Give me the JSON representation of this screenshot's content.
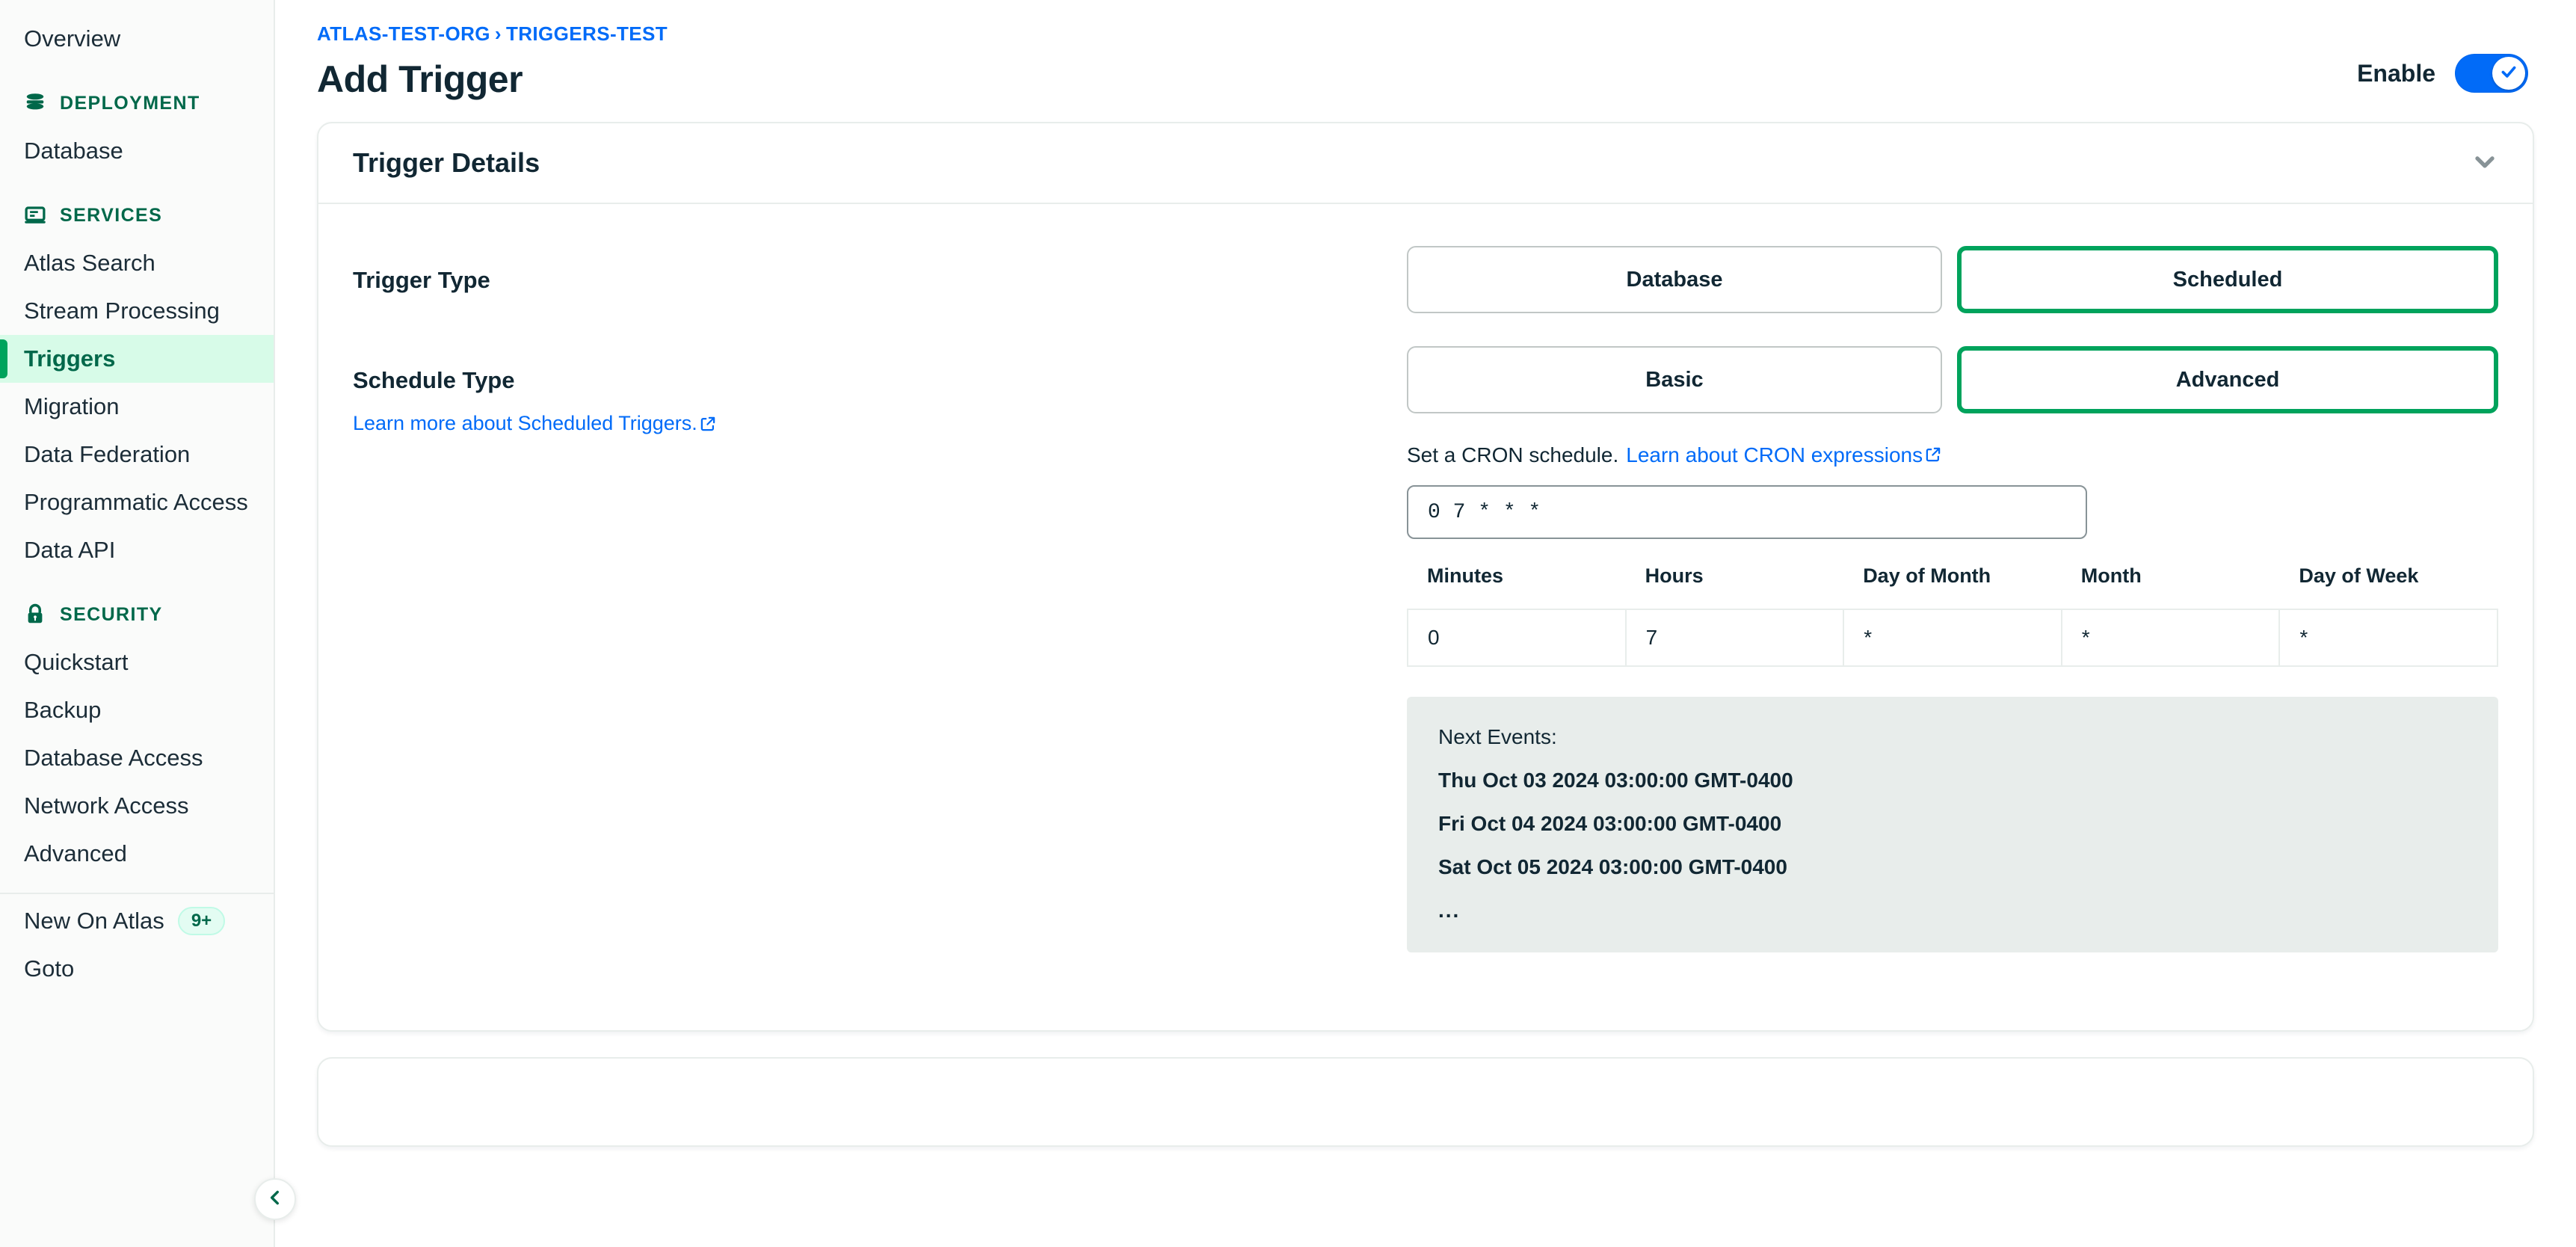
{
  "sidebar": {
    "top_items": [
      {
        "label": "Overview",
        "active": false
      }
    ],
    "sections": [
      {
        "title": "DEPLOYMENT",
        "icon": "database-icon",
        "items": [
          {
            "label": "Database",
            "active": false
          }
        ]
      },
      {
        "title": "SERVICES",
        "icon": "services-icon",
        "items": [
          {
            "label": "Atlas Search",
            "active": false
          },
          {
            "label": "Stream Processing",
            "active": false
          },
          {
            "label": "Triggers",
            "active": true
          },
          {
            "label": "Migration",
            "active": false
          },
          {
            "label": "Data Federation",
            "active": false
          },
          {
            "label": "Programmatic Access",
            "active": false
          },
          {
            "label": "Data API",
            "active": false
          }
        ]
      },
      {
        "title": "SECURITY",
        "icon": "lock-icon",
        "items": [
          {
            "label": "Quickstart",
            "active": false
          },
          {
            "label": "Backup",
            "active": false
          },
          {
            "label": "Database Access",
            "active": false
          },
          {
            "label": "Network Access",
            "active": false
          },
          {
            "label": "Advanced",
            "active": false
          }
        ]
      }
    ],
    "footer_items": [
      {
        "label": "New On Atlas",
        "badge": "9+"
      },
      {
        "label": "Goto",
        "badge": ""
      }
    ],
    "collapse_button_label": "Collapse navigation"
  },
  "header": {
    "breadcrumb_org": "ATLAS-TEST-ORG",
    "breadcrumb_separator": "›",
    "breadcrumb_project": "TRIGGERS-TEST",
    "title": "Add Trigger",
    "enable_label": "Enable",
    "enable_state": "on"
  },
  "trigger_details": {
    "section_title": "Trigger Details",
    "trigger_type": {
      "label": "Trigger Type",
      "options": [
        "Database",
        "Scheduled"
      ],
      "selected": "Scheduled"
    },
    "schedule_type": {
      "label": "Schedule Type",
      "learn_more": "Learn more about Scheduled Triggers.",
      "options": [
        "Basic",
        "Advanced"
      ],
      "selected": "Advanced"
    },
    "cron": {
      "caption_text": "Set a CRON schedule.",
      "caption_link": "Learn about CRON expressions",
      "value": "0 7 * * *",
      "placeholder": "* * * * *",
      "columns": [
        "Minutes",
        "Hours",
        "Day of Month",
        "Month",
        "Day of Week"
      ],
      "values": [
        "0",
        "7",
        "*",
        "*",
        "*"
      ]
    },
    "next_events": {
      "title": "Next Events:",
      "items": [
        "Thu Oct 03 2024 03:00:00 GMT-0400",
        "Fri Oct 04 2024 03:00:00 GMT-0400",
        "Sat Oct 05 2024 03:00:00 GMT-0400"
      ],
      "ellipsis": "..."
    }
  },
  "colors": {
    "accent_green": "#00a35c",
    "dark_green": "#00684a",
    "link_blue": "#016bf8",
    "toggle_on": "#016bf8",
    "panel_gray": "#e8edeb",
    "sidebar_active_bg": "#d7fbe8"
  }
}
